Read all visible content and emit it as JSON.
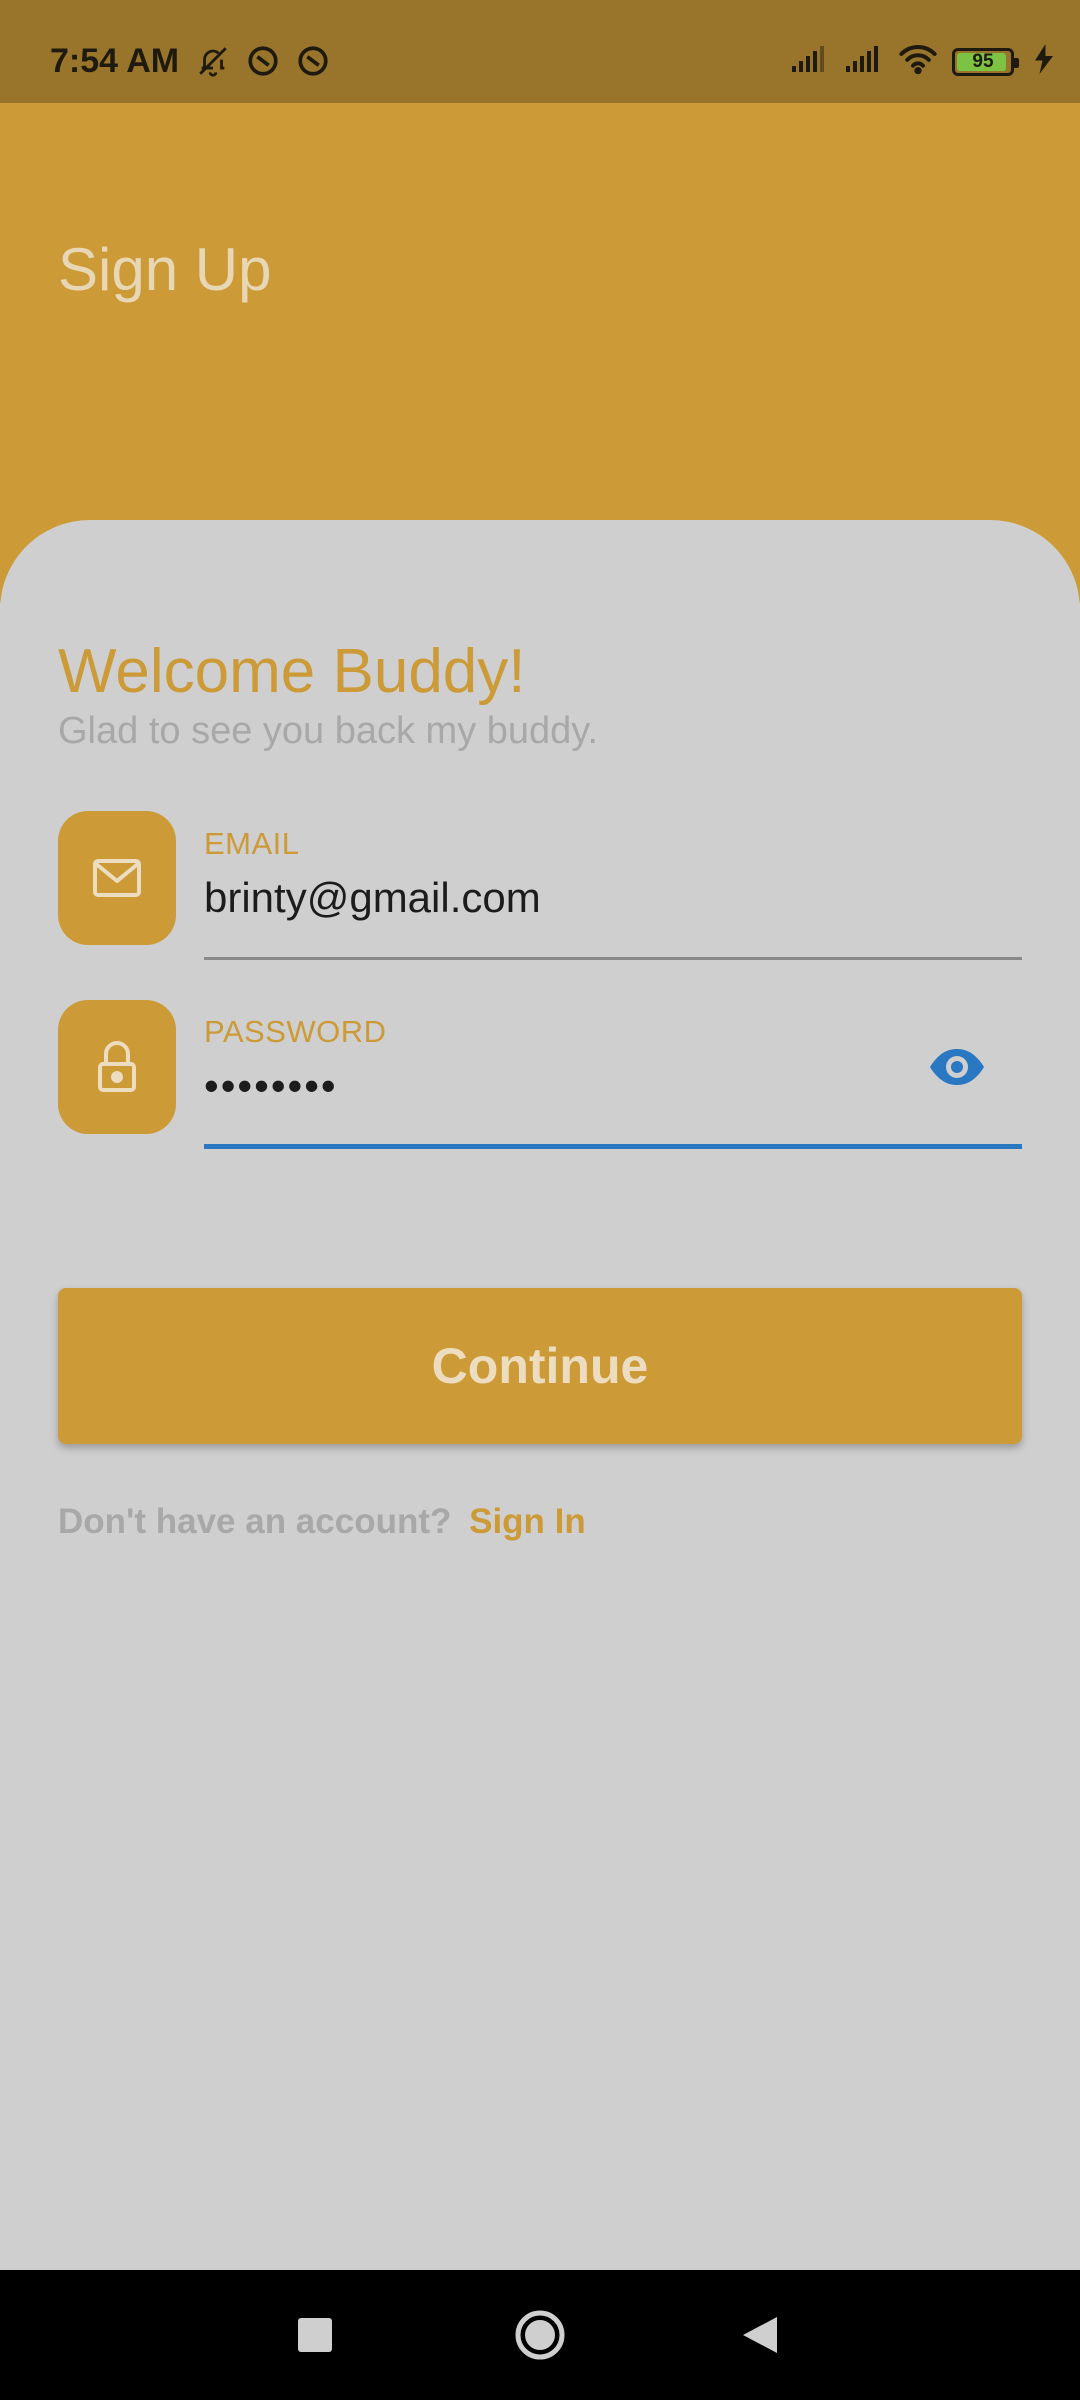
{
  "status_bar": {
    "time": "7:54 AM",
    "battery_level": "95",
    "battery_fill": 0.95,
    "icons_left": [
      "bell-off-icon",
      "do-not-disturb-icon",
      "do-not-disturb-icon"
    ],
    "icons_right": [
      "signal-icon",
      "signal-icon",
      "wifi-icon",
      "battery-icon",
      "charging-icon"
    ]
  },
  "header": {
    "title": "Sign Up"
  },
  "welcome": {
    "title": "Welcome Buddy!",
    "subtitle": "Glad to see you back my buddy."
  },
  "email": {
    "label": "EMAIL",
    "value": "brinty@gmail.com",
    "icon": "mail-icon"
  },
  "password": {
    "label": "PASSWORD",
    "value": "••••••••",
    "icon": "lock-icon",
    "toggle_icon": "eye-icon"
  },
  "continue_label": "Continue",
  "footer": {
    "question": "Don't have an account?",
    "link": "Sign In"
  },
  "nav": [
    "recents-square-icon",
    "home-circle-icon",
    "back-triangle-icon"
  ],
  "colors": {
    "accent": "#cc9a36",
    "status_bar": "#98752a",
    "background": "#cfcfcf",
    "focus_underline": "#2a78c2"
  }
}
